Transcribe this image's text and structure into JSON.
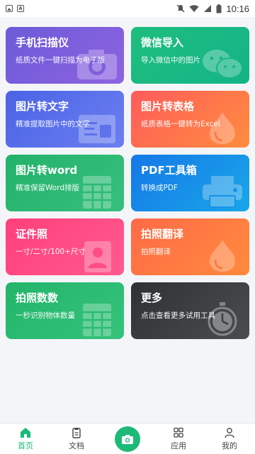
{
  "statusbar": {
    "time": "10:16",
    "left_icons": [
      "image-notification-icon",
      "a-notification-icon"
    ],
    "right_icons": [
      "mute-icon",
      "wifi-icon",
      "signal-icon",
      "battery-icon"
    ]
  },
  "cards": [
    {
      "title": "手机扫描仪",
      "subtitle": "纸质文件一键扫描为电子版",
      "icon": "camera-icon"
    },
    {
      "title": "微信导入",
      "subtitle": "导入微信中的图片",
      "icon": "wechat-icon"
    },
    {
      "title": "图片转文字",
      "subtitle": "精准提取图片中的文字",
      "icon": "text-recognize-icon"
    },
    {
      "title": "图片转表格",
      "subtitle": "纸质表格一键转为Excel",
      "icon": "drop-icon"
    },
    {
      "title": "图片转word",
      "subtitle": "精准保留Word排版",
      "icon": "table-icon"
    },
    {
      "title": "PDF工具箱",
      "subtitle": "转换成PDF",
      "icon": "printer-icon"
    },
    {
      "title": "证件照",
      "subtitle": "一寸/二寸/100+尺寸",
      "icon": "id-photo-icon"
    },
    {
      "title": "拍照翻译",
      "subtitle": "拍照翻译",
      "icon": "drop-icon"
    },
    {
      "title": "拍照数数",
      "subtitle": "一秒识别物体数量",
      "icon": "table-icon"
    },
    {
      "title": "更多",
      "subtitle": "点击查看更多试用工具",
      "icon": "stopwatch-icon"
    }
  ],
  "nav": {
    "items": [
      {
        "label": "首页",
        "icon": "home-icon"
      },
      {
        "label": "文档",
        "icon": "clipboard-icon"
      },
      {
        "label": "",
        "icon": "camera-icon"
      },
      {
        "label": "应用",
        "icon": "apps-grid-icon"
      },
      {
        "label": "我的",
        "icon": "user-icon"
      }
    ],
    "active_color": "#1db978"
  }
}
